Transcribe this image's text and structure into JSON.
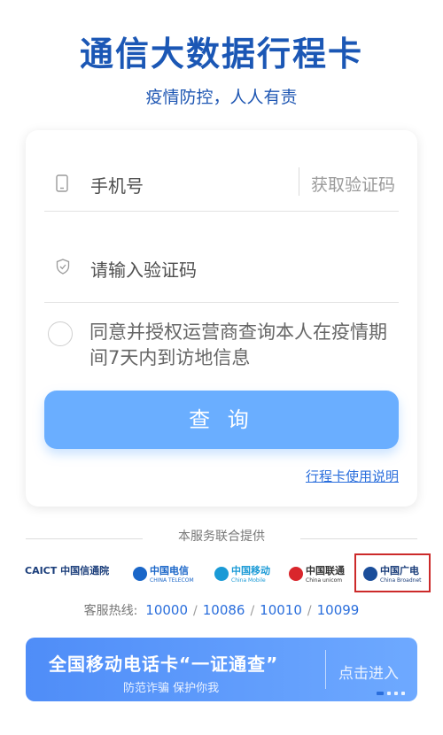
{
  "header": {
    "title": "通信大数据行程卡",
    "subtitle": "疫情防控，人人有责"
  },
  "form": {
    "phone_placeholder": "手机号",
    "get_code_label": "获取验证码",
    "code_placeholder": "请输入验证码",
    "agree_text": "同意并授权运营商查询本人在疫情期间7天内到访地信息",
    "query_button": "查 询",
    "help_link": "行程卡使用说明"
  },
  "providers": {
    "heading": "本服务联合提供",
    "logos": [
      {
        "name": "CAICT 中国信通院",
        "sub": ""
      },
      {
        "name": "中国电信",
        "sub": "CHINA TELECOM"
      },
      {
        "name": "中国移动",
        "sub": "China Mobile"
      },
      {
        "name": "中国联通",
        "sub": "China unicom"
      },
      {
        "name": "中国广电",
        "sub": "China Broadnet"
      }
    ]
  },
  "hotline": {
    "label": "客服热线:",
    "numbers": [
      "10000",
      "10086",
      "10010",
      "10099"
    ]
  },
  "banner": {
    "title": "全国移动电话卡“一证通查”",
    "subtitle": "防范诈骗 保护你我",
    "enter": "点击进入"
  },
  "colors": {
    "title_blue": "#1b57b5",
    "button_blue": "#6aaeff",
    "link_blue": "#2a6edc",
    "highlight_red": "#cc2a2a"
  }
}
